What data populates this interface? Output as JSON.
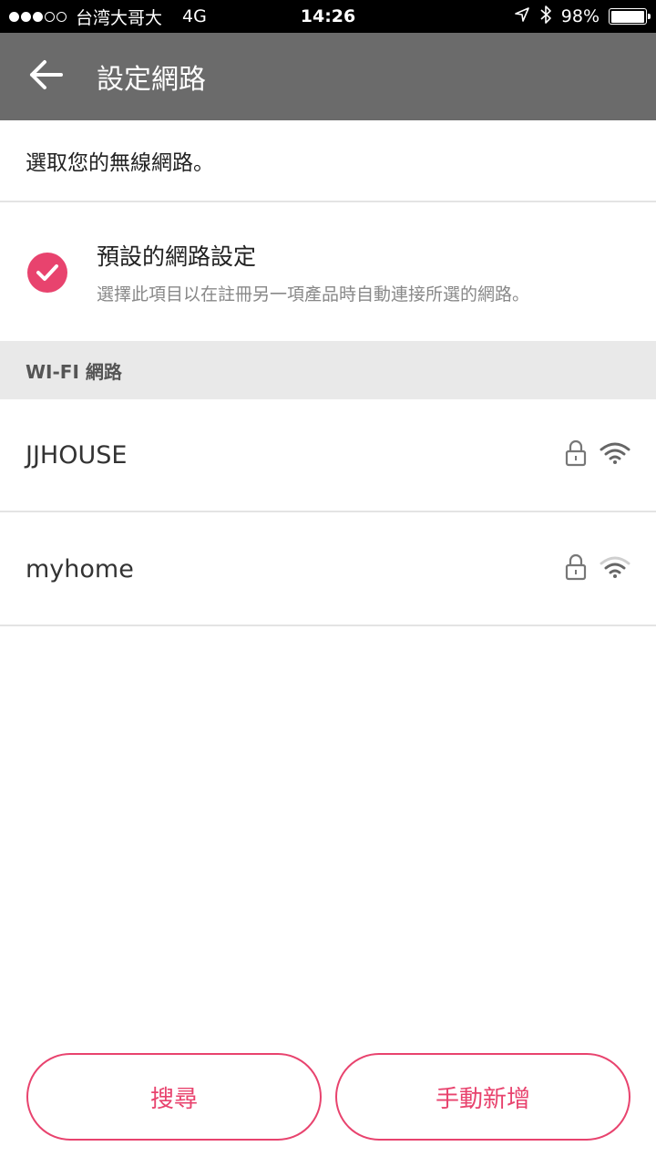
{
  "status_bar": {
    "carrier": "台湾大哥大",
    "network": "4G",
    "time": "14:26",
    "battery": "98%",
    "battery_level": 0.98
  },
  "app_bar": {
    "title": "設定網路",
    "back_icon": "arrow-left-icon"
  },
  "intro": {
    "text": "選取您的無線網路。"
  },
  "default_setting": {
    "checked": true,
    "title": "預設的網路設定",
    "description": "選擇此項目以在註冊另一項產品時自動連接所選的網路。"
  },
  "section": {
    "header": "WI-FI 網路"
  },
  "networks": [
    {
      "name": "JJHOUSE",
      "secured": true,
      "signal": "full"
    },
    {
      "name": "myhome",
      "secured": true,
      "signal": "medium"
    }
  ],
  "buttons": {
    "search": "搜尋",
    "add_manual": "手動新增"
  },
  "colors": {
    "accent": "#e8436e",
    "app_bar": "#6b6b6b",
    "section_bg": "#e9e9e9"
  }
}
